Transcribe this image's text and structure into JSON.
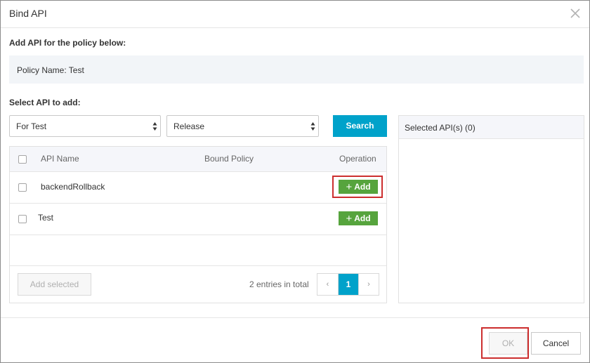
{
  "dialog": {
    "title": "Bind API",
    "close_icon": "close-icon"
  },
  "policy_section": {
    "label": "Add API for the policy below:",
    "policy_name": "Policy Name: Test"
  },
  "select_section": {
    "label": "Select API to add:",
    "group_select": "For Test",
    "env_select": "Release",
    "search_label": "Search"
  },
  "table": {
    "headers": [
      "API Name",
      "Bound Policy",
      "Operation"
    ],
    "rows": [
      {
        "name": "backendRollback",
        "action": "Add",
        "highlighted": true
      },
      {
        "name": "Test",
        "action": "Add",
        "highlighted": false
      }
    ],
    "add_selected_label": "Add selected",
    "entries_text": "2 entries in total",
    "pager": {
      "prev": "‹",
      "current": "1",
      "next": "›"
    }
  },
  "selected_panel": {
    "title": "Selected API(s) (0)"
  },
  "footer": {
    "ok_label": "OK",
    "cancel_label": "Cancel"
  },
  "colors": {
    "primary": "#00a2ca",
    "add_button": "#56a43d",
    "highlight": "#cc2e2e"
  }
}
